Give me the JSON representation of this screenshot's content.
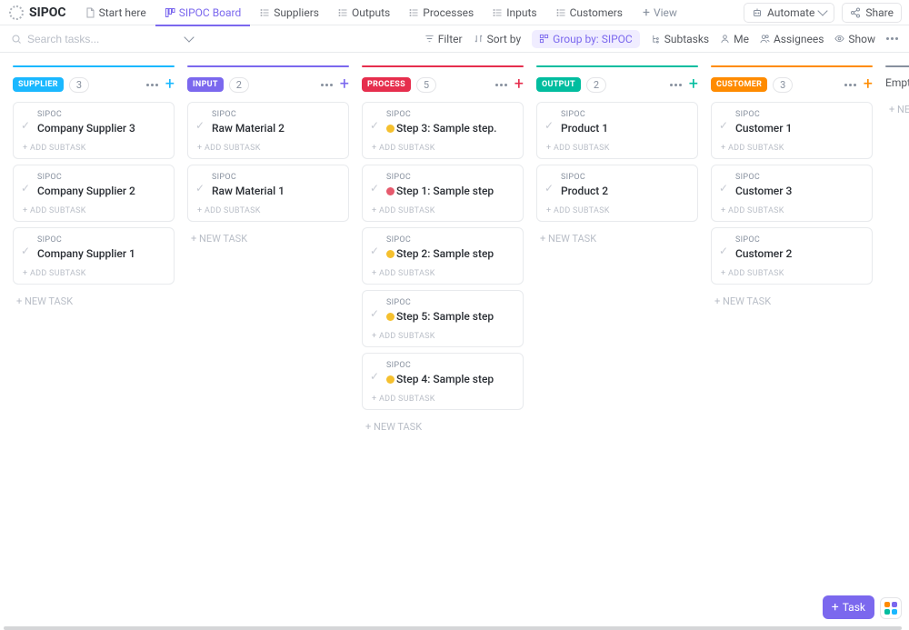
{
  "app": {
    "title": "SIPOC"
  },
  "tabs": [
    {
      "label": "Start here",
      "active": false
    },
    {
      "label": "SIPOC Board",
      "active": true
    },
    {
      "label": "Suppliers",
      "active": false
    },
    {
      "label": "Outputs",
      "active": false
    },
    {
      "label": "Processes",
      "active": false
    },
    {
      "label": "Inputs",
      "active": false
    },
    {
      "label": "Customers",
      "active": false
    }
  ],
  "viewAdd": "View",
  "topButtons": {
    "automate": "Automate",
    "share": "Share"
  },
  "search": {
    "placeholder": "Search tasks..."
  },
  "filters": {
    "filter": "Filter",
    "sort": "Sort by",
    "group": "Group by: SIPOC",
    "subtasks": "Subtasks",
    "me": "Me",
    "assignees": "Assignees",
    "show": "Show"
  },
  "strings": {
    "breadcrumb": "SIPOC",
    "addSubtask": "+ ADD SUBTASK",
    "newTask": "+ NEW TASK",
    "newTaskShort": "+ NE"
  },
  "columns": [
    {
      "name": "SUPPLIER",
      "count": "3",
      "color": "#1ab8ff",
      "dividerColor": "#1ab8ff",
      "plusColor": "#1ab8ff",
      "cards": [
        {
          "title": "Company Supplier 3",
          "status": null
        },
        {
          "title": "Company Supplier 2",
          "status": null
        },
        {
          "title": "Company Supplier 1",
          "status": null
        }
      ]
    },
    {
      "name": "INPUT",
      "count": "2",
      "color": "#7b68ee",
      "dividerColor": "#7b68ee",
      "plusColor": "#7b68ee",
      "cards": [
        {
          "title": "Raw Material 2",
          "status": null
        },
        {
          "title": "Raw Material 1",
          "status": null
        }
      ]
    },
    {
      "name": "PROCESS",
      "count": "5",
      "color": "#e62e4d",
      "dividerColor": "#e62e4d",
      "plusColor": "#e62e4d",
      "cards": [
        {
          "title": "Step 3: Sample step.",
          "status": "#f5c02e"
        },
        {
          "title": "Step 1: Sample step",
          "status": "#e65a6d"
        },
        {
          "title": "Step 2: Sample step",
          "status": "#f5c02e"
        },
        {
          "title": "Step 5: Sample step",
          "status": "#f5c02e"
        },
        {
          "title": "Step 4: Sample step",
          "status": "#f5c02e"
        }
      ]
    },
    {
      "name": "OUTPUT",
      "count": "2",
      "color": "#02bd9f",
      "dividerColor": "#02bd9f",
      "plusColor": "#02bd9f",
      "cards": [
        {
          "title": "Product 1",
          "status": null
        },
        {
          "title": "Product 2",
          "status": null
        }
      ]
    },
    {
      "name": "CUSTOMER",
      "count": "3",
      "color": "#ff8b00",
      "dividerColor": "#ff8b00",
      "plusColor": "#ff8b00",
      "cards": [
        {
          "title": "Customer 1",
          "status": null
        },
        {
          "title": "Customer 3",
          "status": null
        },
        {
          "title": "Customer 2",
          "status": null
        }
      ]
    },
    {
      "name": "Empty",
      "count": null,
      "color": null,
      "dividerColor": "#87909e",
      "plusColor": "#87909e",
      "cards": [],
      "labelOnly": true
    }
  ],
  "fab": {
    "task": "Task"
  }
}
